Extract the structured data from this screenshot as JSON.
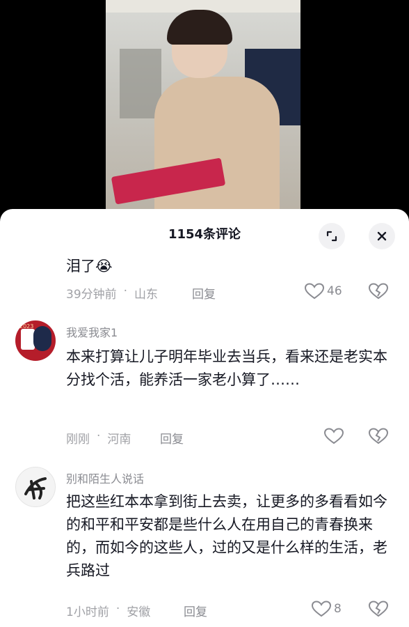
{
  "header": {
    "title": "1154条评论"
  },
  "comments": [
    {
      "text": "泪了",
      "emoji": "😭",
      "time": "39分钟前",
      "location": "山东",
      "reply": "回复",
      "likes": "46"
    },
    {
      "user": "我爱我家1",
      "text": "本来打算让儿子明年毕业去当兵，看来还是老实本分找个活，能养活一家老小算了……",
      "time": "刚刚",
      "location": "河南",
      "reply": "回复",
      "likes": ""
    },
    {
      "user": "别和陌生人说话",
      "text": "把这些红本本拿到街上去卖，让更多的多看看如今的和平和平安都是些什么人在用自己的青春换来的，而如今的这些人，过的又是什么样的生活，老兵路过",
      "time": "1小时前",
      "location": "安徽",
      "reply": "回复",
      "likes": "8"
    }
  ],
  "meta_sep": "·",
  "avatar2_text": "2023"
}
